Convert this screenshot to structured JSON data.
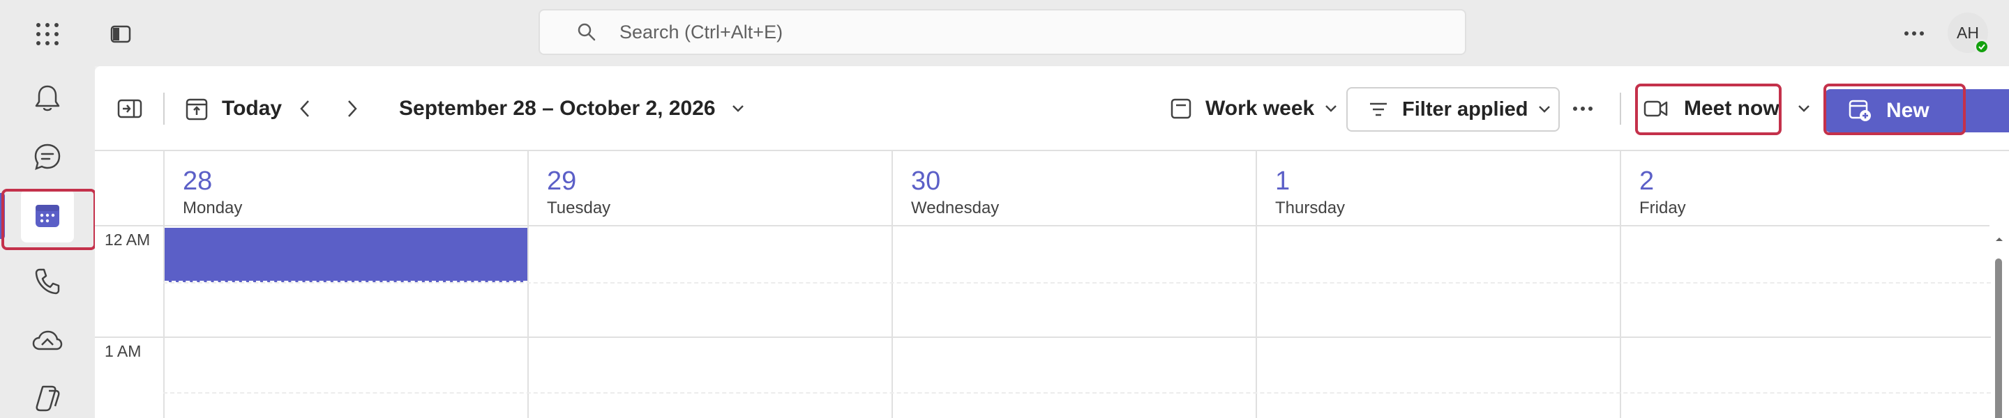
{
  "search": {
    "placeholder": "Search (Ctrl+Alt+E)"
  },
  "user": {
    "initials": "AH",
    "presence": "available"
  },
  "rail": {
    "items": [
      {
        "name": "Activity",
        "icon": "bell-icon"
      },
      {
        "name": "Chat",
        "icon": "chat-icon"
      },
      {
        "name": "Calendar",
        "icon": "calendar-icon",
        "active": true
      },
      {
        "name": "Calls",
        "icon": "phone-icon"
      },
      {
        "name": "OneDrive",
        "icon": "cloud-icon"
      },
      {
        "name": "Copilot",
        "icon": "copilot-icon"
      }
    ]
  },
  "toolbar": {
    "today_label": "Today",
    "date_range": "September 28 – October 2, 2026",
    "view_label": "Work week",
    "filter_label": "Filter applied",
    "meet_now_label": "Meet now",
    "new_label": "New"
  },
  "calendar": {
    "days": [
      {
        "num": "28",
        "name": "Monday"
      },
      {
        "num": "29",
        "name": "Tuesday"
      },
      {
        "num": "30",
        "name": "Wednesday"
      },
      {
        "num": "1",
        "name": "Thursday"
      },
      {
        "num": "2",
        "name": "Friday"
      }
    ],
    "times": [
      "12 AM",
      "1 AM"
    ]
  },
  "colors": {
    "accent": "#5b5fc7",
    "highlight": "#c4314b",
    "presence": "#13a10e"
  }
}
